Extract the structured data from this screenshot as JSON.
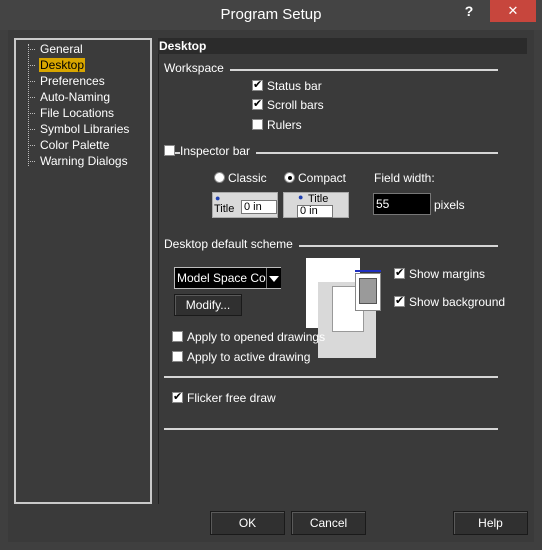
{
  "window": {
    "title": "Program Setup",
    "help_glyph": "?",
    "close_glyph": "✕"
  },
  "tree": {
    "items": [
      {
        "label": "General"
      },
      {
        "label": "Desktop"
      },
      {
        "label": "Preferences"
      },
      {
        "label": "Auto-Naming"
      },
      {
        "label": "File Locations"
      },
      {
        "label": "Symbol Libraries"
      },
      {
        "label": "Color Palette"
      },
      {
        "label": "Warning Dialogs"
      }
    ],
    "selected": "Desktop"
  },
  "panel": {
    "header": "Desktop",
    "workspace": {
      "label": "Workspace",
      "status_bar": {
        "label": "Status bar",
        "checked": true
      },
      "scroll_bars": {
        "label": "Scroll bars",
        "checked": true
      },
      "rulers": {
        "label": "Rulers",
        "checked": false
      }
    },
    "inspector": {
      "label": "Inspector bar",
      "checked": false,
      "classic_label": "Classic",
      "compact_label": "Compact",
      "selected": "Compact",
      "field_width_label": "Field width:",
      "field_width_value": "55",
      "field_width_unit": "pixels",
      "preview_title": "Title",
      "preview_value": "0 in"
    },
    "scheme": {
      "label": "Desktop default scheme",
      "selected_value": "Model Space Colo",
      "modify_label": "Modify...",
      "show_margins": {
        "label": "Show margins",
        "checked": true
      },
      "show_background": {
        "label": "Show background",
        "checked": true
      },
      "apply_opened": {
        "label": "Apply to opened drawings",
        "checked": false
      },
      "apply_active": {
        "label": "Apply to active drawing",
        "checked": false
      }
    },
    "flicker": {
      "label": "Flicker free draw",
      "checked": true
    }
  },
  "footer": {
    "ok_label": "OK",
    "cancel_label": "Cancel",
    "help_label": "Help"
  }
}
